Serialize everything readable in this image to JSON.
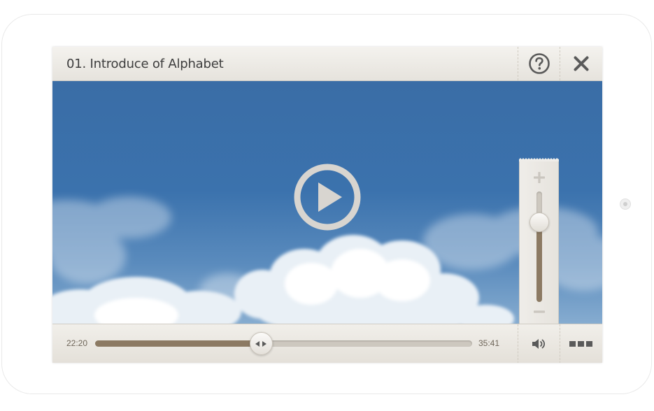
{
  "player": {
    "title": "01. Introduce of Alphabet",
    "help_icon": "help-circle-icon",
    "close_icon": "close-icon",
    "play_icon": "play-circle-icon"
  },
  "controls": {
    "current_time": "22:20",
    "duration": "35:41",
    "progress_fraction": 0.44,
    "volume_icon": "speaker-icon",
    "more_icon": "more-icon"
  },
  "volume": {
    "level_fraction": 0.72,
    "plus_icon": "plus-icon",
    "minus_icon": "minus-icon"
  },
  "colors": {
    "accent": "#8c7a63",
    "sky": "#3b72ad"
  }
}
